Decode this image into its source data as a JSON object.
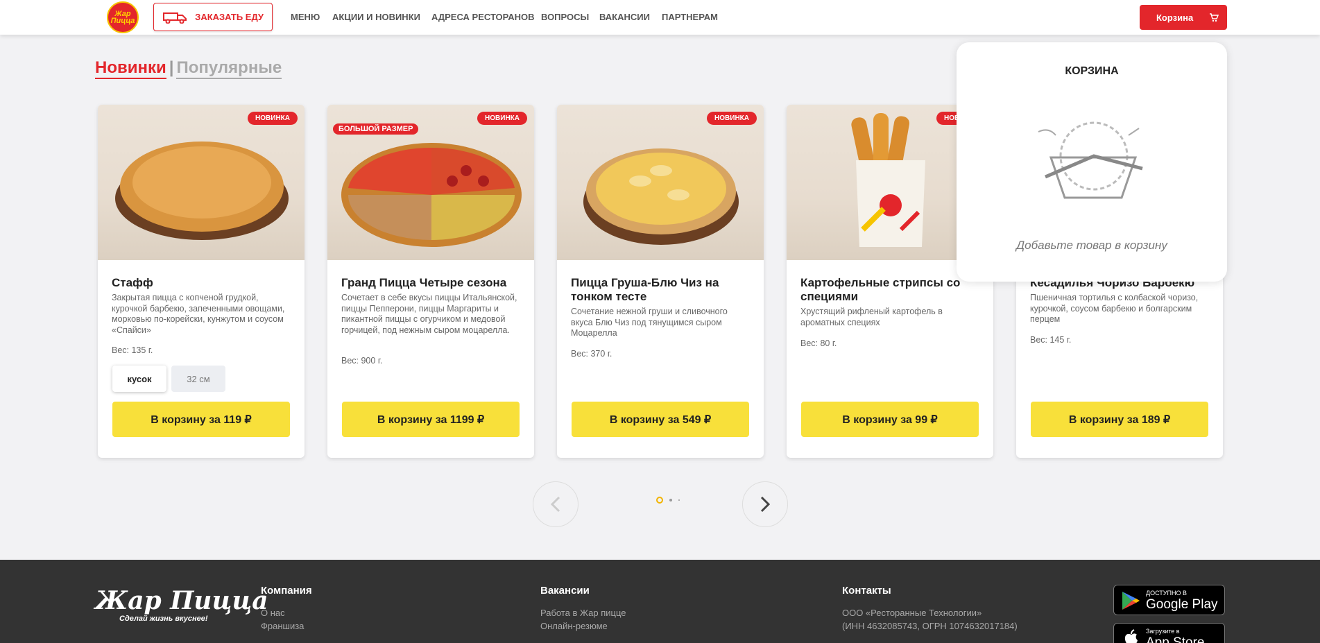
{
  "header": {
    "logo_text": "Жар Пицца",
    "order_button": "ЗАКАЗАТЬ ЕДУ",
    "nav": [
      "МЕНЮ",
      "АКЦИИ И НОВИНКИ",
      "АДРЕСА РЕСТОРАНОВ",
      "ВОПРОСЫ",
      "ВАКАНСИИ",
      "ПАРТНЕРАМ"
    ],
    "cart_button": "Корзина"
  },
  "tabs": {
    "active": "Новинки",
    "separator": "|",
    "other": "Популярные"
  },
  "products": [
    {
      "badge": "НОВИНКА",
      "title": "Стафф",
      "desc": "Закрытая пицца с копченой грудкой, курочкой барбекю, запеченными овощами, морковью по-корейски, кунжутом и соусом «Спайси»",
      "weight": "Вес: 135 г.",
      "sizes": [
        "кусок",
        "32 см"
      ],
      "buy": "В корзину за 119 ₽"
    },
    {
      "badge": "НОВИНКА",
      "label": "БОЛЬШОЙ РАЗМЕР",
      "title": "Гранд Пицца Четыре сезона",
      "desc": "Сочетает в себе вкусы пиццы Итальянской, пиццы Пепперони, пиццы Маргариты и пикантной пиццы с огурчиком и медовой горчицей, под нежным сыром моцарелла.",
      "weight": "Вес: 900 г.",
      "buy": "В корзину за 1199 ₽"
    },
    {
      "badge": "НОВИНКА",
      "title": "Пицца Груша-Блю Чиз на тонком тесте",
      "desc": "Сочетание нежной груши и сливочного вкуса Блю Чиз под тянущимся сыром Моцарелла",
      "weight": "Вес: 370 г.",
      "buy": "В корзину за 549 ₽"
    },
    {
      "badge": "НОВИНКА",
      "title": "Картофельные стрипсы со специями",
      "desc": "Хрустящий рифленый картофель в ароматных специях",
      "weight": "Вес: 80 г.",
      "buy": "В корзину за 99 ₽"
    },
    {
      "title": "Кесадилья Чоризо Барбекю",
      "desc": "Пшеничная тортилья с колбаской чоризо, курочкой, соусом барбекю и болгарским перцем",
      "weight": "Вес: 145 г.",
      "buy": "В корзину за 189 ₽"
    }
  ],
  "cart_panel": {
    "title": "КОРЗИНА",
    "empty_text": "Добавьте товар в корзину"
  },
  "footer": {
    "brand": "Жар Пицца",
    "slogan": "Сделай жизнь вкуснее!",
    "company": {
      "heading": "Компания",
      "links": [
        "О нас",
        "Франшиза"
      ]
    },
    "vacancies": {
      "heading": "Вакансии",
      "links": [
        "Работа в Жар пицце",
        "Онлайн-резюме"
      ]
    },
    "contacts": {
      "heading": "Контакты",
      "lines": [
        "ООО «Ресторанные Технологии»",
        "(ИНН 4632085743, ОГРН 1074632017184)"
      ]
    },
    "google_play": {
      "small": "ДОСТУПНО В",
      "big": "Google Play"
    },
    "app_store": {
      "small": "Загрузите в",
      "big": "App Store"
    }
  },
  "colors": {
    "accent": "#e3262b",
    "button": "#f8e03a",
    "footer": "#333333"
  }
}
